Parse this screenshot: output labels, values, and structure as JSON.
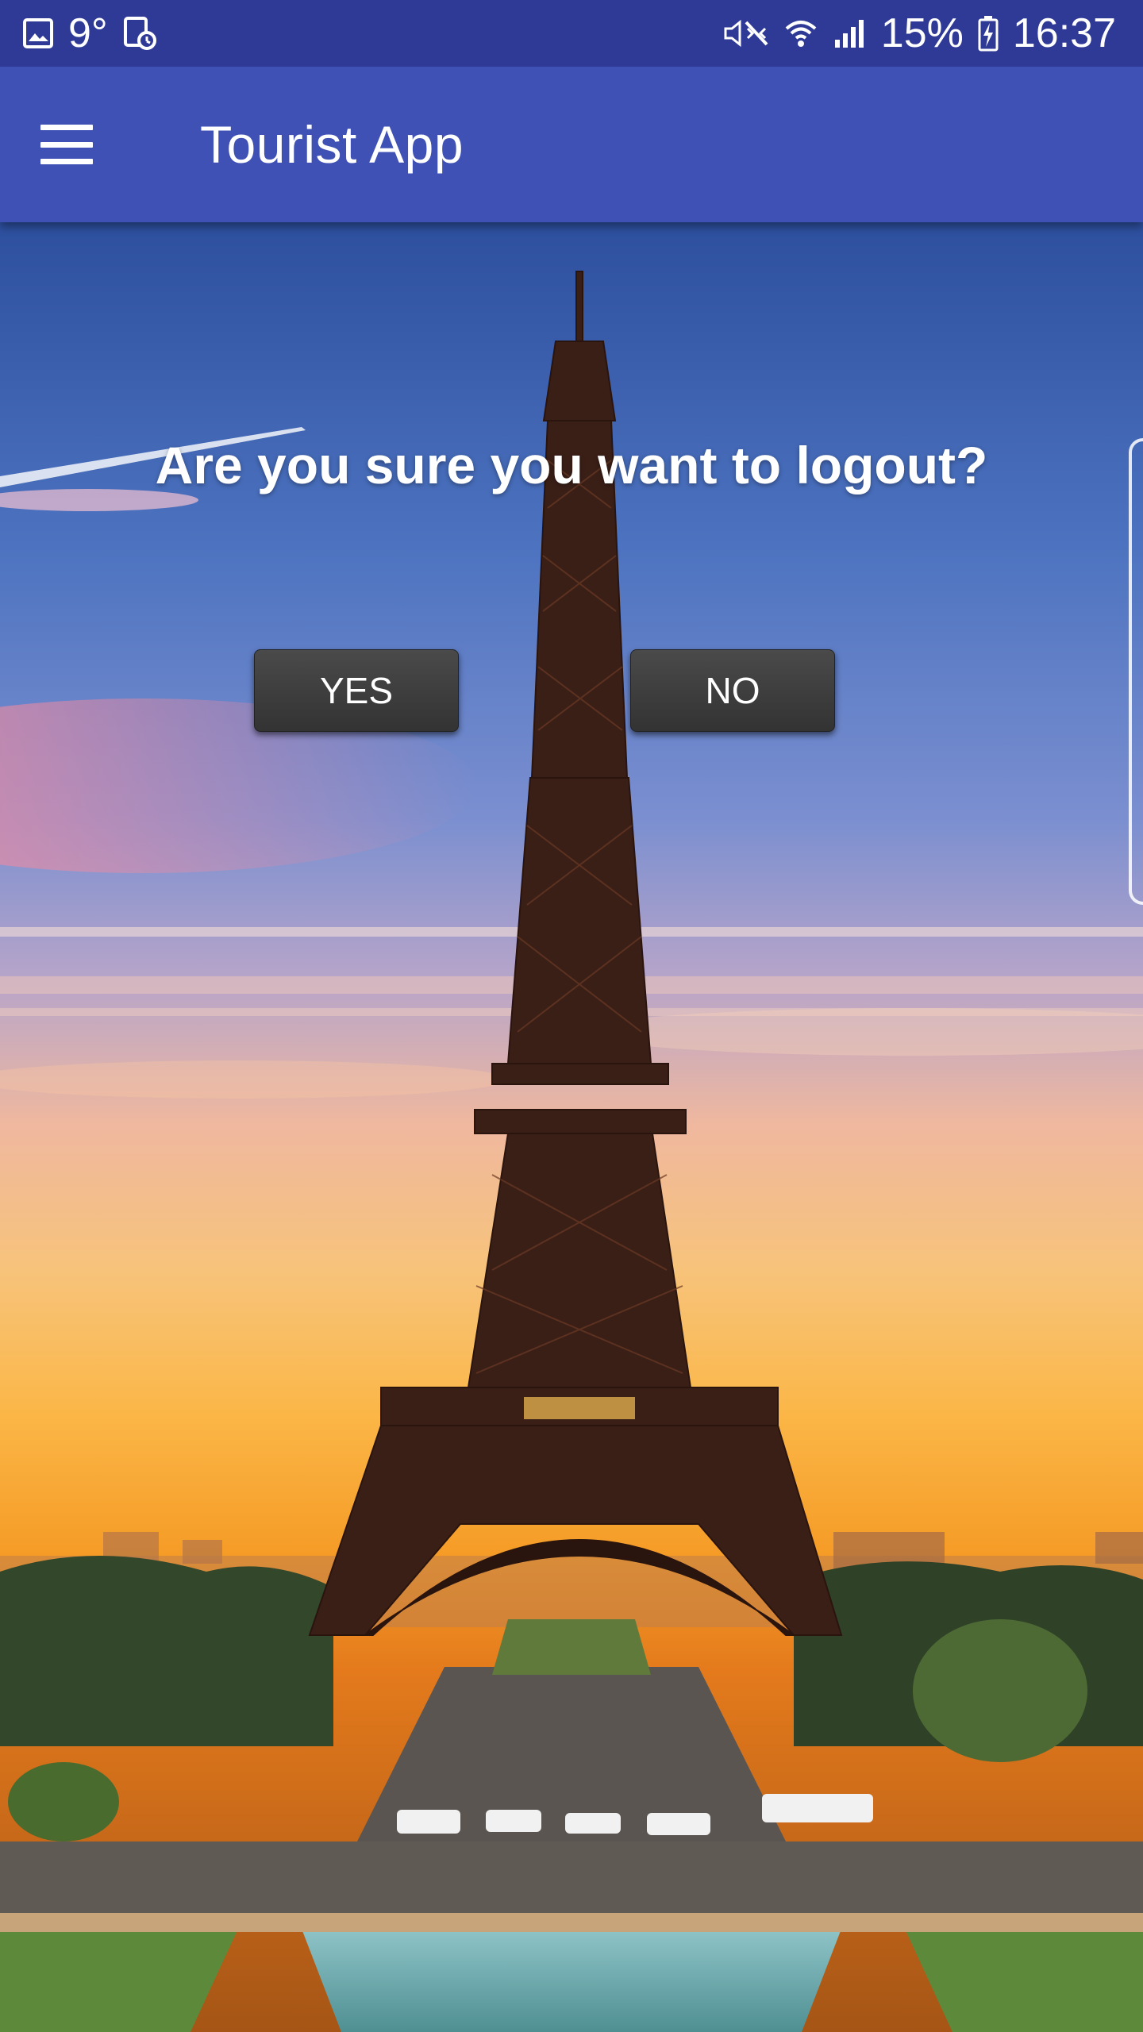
{
  "status_bar": {
    "temperature": "9°",
    "battery": "15%",
    "time": "16:37",
    "icons": [
      "gallery-icon",
      "calendar-clock-icon",
      "mute-icon",
      "wifi-icon",
      "signal-icon",
      "battery-charging-icon"
    ]
  },
  "app_bar": {
    "title": "Tourist App",
    "menu_icon": "hamburger-menu-icon",
    "color": "#3f51b5"
  },
  "dialog": {
    "question": "Are you sure you want to logout?",
    "yes_label": "YES",
    "no_label": "NO"
  },
  "background": {
    "description_icon": "eiffel-tower-sunset-image"
  }
}
